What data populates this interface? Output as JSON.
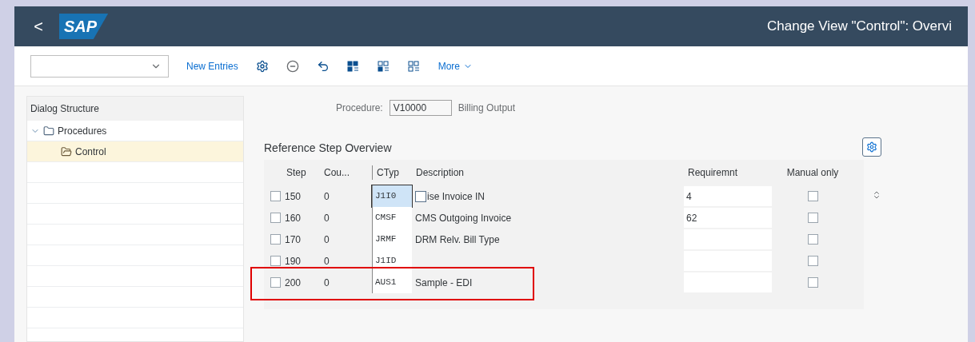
{
  "header": {
    "back": "<",
    "logo": "SAP",
    "title": "Change View \"Control\": Overvi"
  },
  "toolbar": {
    "buttons": [
      "New Entries"
    ],
    "more": "More"
  },
  "dialog_structure": {
    "title": "Dialog Structure",
    "items": [
      {
        "label": "Procedures",
        "expanded": true,
        "selected": false,
        "children": [
          {
            "label": "Control",
            "selected": true
          }
        ]
      }
    ]
  },
  "procedure": {
    "label": "Procedure:",
    "value": "V10000",
    "description": "Billing Output"
  },
  "table": {
    "title": "Reference Step Overview",
    "columns": [
      "Step",
      "Cou...",
      "CTyp",
      "Description",
      "Requiremnt",
      "Manual only"
    ],
    "rows": [
      {
        "selected": false,
        "step": "150",
        "counter": "0",
        "ctyp": "J1I0",
        "focused": true,
        "description": "ise Invoice IN",
        "requirement": "4",
        "manual_only": false,
        "highlighted": false
      },
      {
        "selected": false,
        "step": "160",
        "counter": "0",
        "ctyp": "CMSF",
        "focused": false,
        "description": "CMS Outgoing Invoice",
        "requirement": "62",
        "manual_only": false,
        "highlighted": false
      },
      {
        "selected": false,
        "step": "170",
        "counter": "0",
        "ctyp": "JRMF",
        "focused": false,
        "description": "DRM Relv. Bill Type",
        "manual_only": false,
        "highlighted": false
      },
      {
        "selected": false,
        "step": "190",
        "counter": "0",
        "ctyp": "J1ID",
        "focused": false,
        "manual_only": false,
        "highlighted": false
      },
      {
        "selected": false,
        "step": "200",
        "counter": "0",
        "ctyp": "AUS1",
        "focused": false,
        "description": "Sample - EDI",
        "manual_only": false,
        "highlighted": true
      }
    ]
  }
}
